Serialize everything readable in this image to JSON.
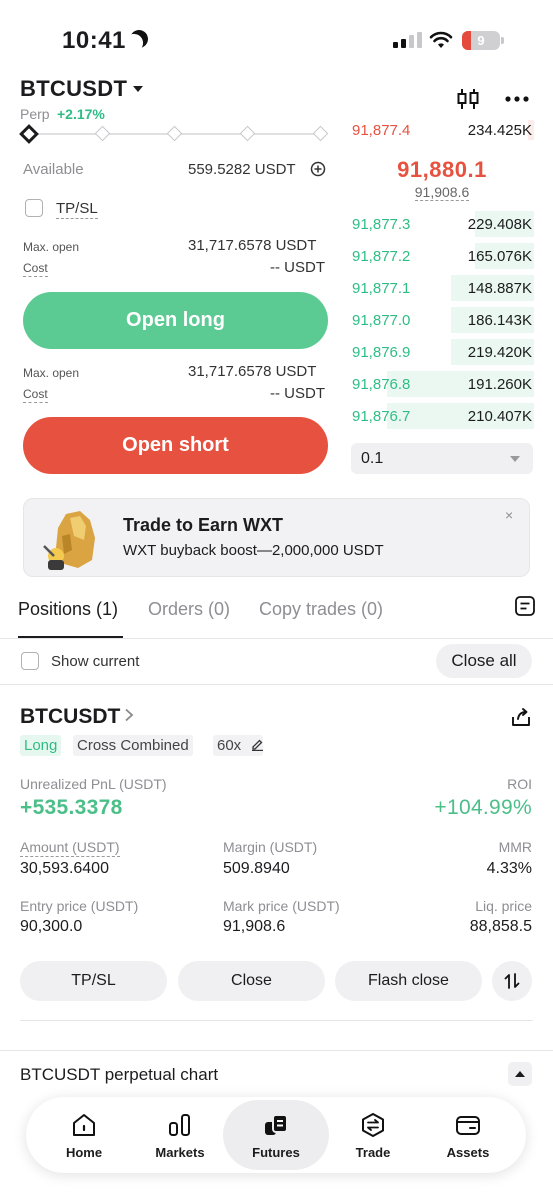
{
  "status_bar": {
    "time": "10:41",
    "battery": "9"
  },
  "header": {
    "pair": "BTCUSDT",
    "contract": "Perp",
    "change": "+2.17%"
  },
  "order_form": {
    "available_label": "Available",
    "available_value": "559.5282 USDT",
    "tpsl_label": "TP/SL",
    "long": {
      "max_open_label": "Max. open",
      "max_open_value": "31,717.6578 USDT",
      "cost_label": "Cost",
      "cost_value": "-- USDT",
      "button": "Open long"
    },
    "short": {
      "max_open_label": "Max. open",
      "max_open_value": "31,717.6578 USDT",
      "cost_label": "Cost",
      "cost_value": "-- USDT",
      "button": "Open short"
    }
  },
  "order_book": {
    "top_ask": {
      "price": "91,877.4",
      "qty": "234.425K"
    },
    "last_price": "91,880.1",
    "mark_price": "91,908.6",
    "bids": [
      {
        "price": "91,877.3",
        "qty": "229.408K",
        "depth": 0.32
      },
      {
        "price": "91,877.2",
        "qty": "165.076K",
        "depth": 0.32
      },
      {
        "price": "91,877.1",
        "qty": "148.887K",
        "depth": 0.45
      },
      {
        "price": "91,877.0",
        "qty": "186.143K",
        "depth": 0.45
      },
      {
        "price": "91,876.9",
        "qty": "219.420K",
        "depth": 0.45
      },
      {
        "price": "91,876.8",
        "qty": "191.260K",
        "depth": 0.8
      },
      {
        "price": "91,876.7",
        "qty": "210.407K",
        "depth": 0.8
      }
    ],
    "precision": "0.1"
  },
  "promo": {
    "title": "Trade to Earn WXT",
    "subtitle": "WXT buyback boost—2,000,000 USDT",
    "close": "×"
  },
  "tabs": [
    {
      "label": "Positions (1)"
    },
    {
      "label": "Orders (0)"
    },
    {
      "label": "Copy trades (0)"
    }
  ],
  "filters": {
    "show_current": "Show current",
    "close_all": "Close all"
  },
  "position": {
    "symbol": "BTCUSDT",
    "side": "Long",
    "margin_mode": "Cross Combined",
    "leverage": "60x",
    "pnl_label": "Unrealized PnL (USDT)",
    "pnl_value": "+535.3378",
    "roi_label": "ROI",
    "roi_value": "+104.99%",
    "amount_label": "Amount (USDT)",
    "amount_value": "30,593.6400",
    "margin_label": "Margin (USDT)",
    "margin_value": "509.8940",
    "mmr_label": "MMR",
    "mmr_value": "4.33%",
    "entry_label": "Entry price (USDT)",
    "entry_value": "90,300.0",
    "mark_label": "Mark price (USDT)",
    "mark_value": "91,908.6",
    "liq_label": "Liq. price",
    "liq_value": "88,858.5",
    "actions": {
      "tpsl": "TP/SL",
      "close": "Close",
      "flash_close": "Flash close"
    }
  },
  "chart_section": {
    "title": "BTCUSDT perpetual chart"
  },
  "bottom_nav": [
    {
      "label": "Home",
      "icon": "home-icon"
    },
    {
      "label": "Markets",
      "icon": "markets-icon"
    },
    {
      "label": "Futures",
      "icon": "futures-icon"
    },
    {
      "label": "Trade",
      "icon": "trade-icon"
    },
    {
      "label": "Assets",
      "icon": "wallet-icon"
    }
  ],
  "colors": {
    "green": "#2fbd85",
    "red": "#e7513f",
    "long_button": "#5ccb93",
    "short_button": "#e7513f"
  }
}
